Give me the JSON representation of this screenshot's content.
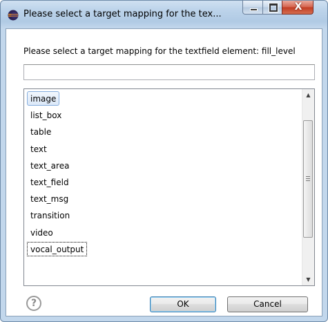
{
  "window": {
    "title": "Please select a target mapping for the tex...",
    "buttons": {
      "minimize_icon": "minimize-icon",
      "maximize_icon": "maximize-icon",
      "close_glyph": "X"
    }
  },
  "dialog": {
    "prompt": "Please select a target mapping for the textfield element: fill_level",
    "filter_value": "",
    "items": [
      {
        "label": "image"
      },
      {
        "label": "list_box"
      },
      {
        "label": "table"
      },
      {
        "label": "text"
      },
      {
        "label": "text_area"
      },
      {
        "label": "text_field"
      },
      {
        "label": "text_msg"
      },
      {
        "label": "transition"
      },
      {
        "label": "video"
      },
      {
        "label": "vocal_output"
      }
    ],
    "selected_item": "image",
    "focused_item": "vocal_output",
    "scroll_position_fraction": 0.35
  },
  "footer": {
    "help_glyph": "?",
    "ok_label": "OK",
    "cancel_label": "Cancel"
  },
  "colors": {
    "selection_border": "#84acdd",
    "ok_border": "#3c7fb1",
    "close_button": "#c13b22"
  }
}
